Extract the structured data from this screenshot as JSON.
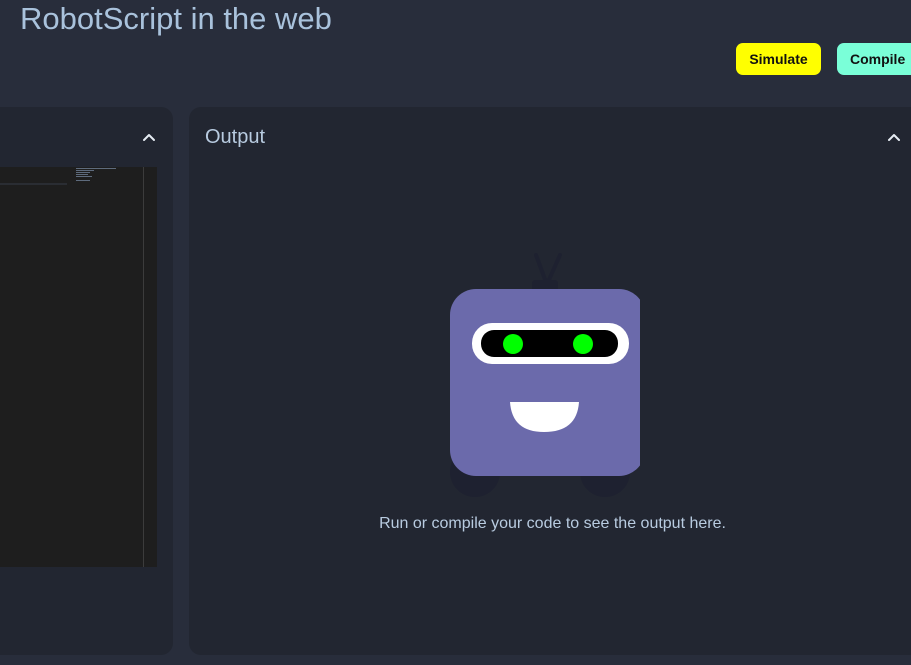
{
  "header": {
    "title": "RobotScript in the web",
    "simulate_label": "Simulate",
    "compile_label": "Compile"
  },
  "editor_panel": {
    "collapse_icon": "chevron-up-icon"
  },
  "output_panel": {
    "title": "Output",
    "collapse_icon": "chevron-up-icon",
    "illustration_icon": "robot-icon",
    "empty_message": "Run or compile your code to see the output here."
  },
  "colors": {
    "background": "#282d3b",
    "panel": "#222631",
    "simulate_button": "#ffff00",
    "compile_button": "#7affd8",
    "robot_body": "#6b6aab",
    "robot_eyes": "#00ff00"
  }
}
